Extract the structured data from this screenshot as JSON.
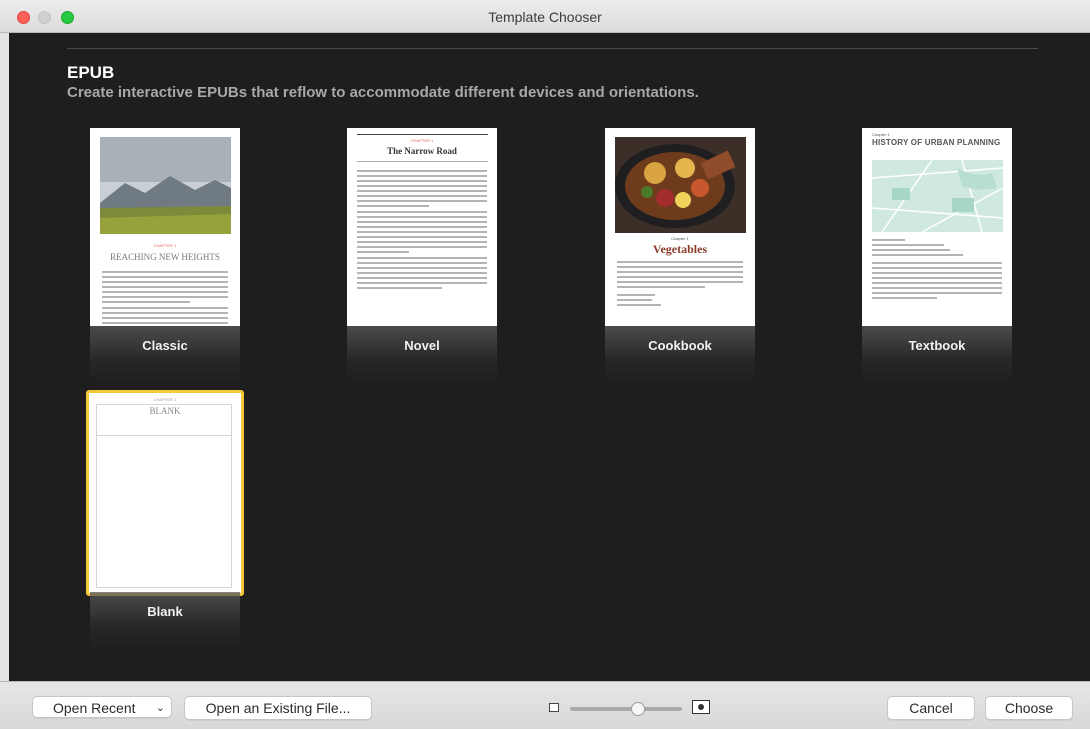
{
  "window": {
    "title": "Template Chooser"
  },
  "section": {
    "title": "EPUB",
    "description": "Create interactive EPUBs that reflow to accommodate different devices and orientations."
  },
  "templates": [
    {
      "label": "Classic",
      "chapter": "CHAPTER 1",
      "heading": "REACHING NEW HEIGHTS"
    },
    {
      "label": "Novel",
      "chapter": "CHAPTER 1",
      "heading": "The Narrow Road"
    },
    {
      "label": "Cookbook",
      "chapter": "Chapter 1",
      "heading": "Vegetables"
    },
    {
      "label": "Textbook",
      "chapter": "Chapter 1",
      "heading": "HISTORY OF URBAN PLANNING"
    },
    {
      "label": "Blank",
      "chapter": "CHAPTER 1",
      "heading": "BLANK",
      "selected": true
    }
  ],
  "footer": {
    "open_recent": "Open Recent",
    "open_existing": "Open an Existing File...",
    "cancel": "Cancel",
    "choose": "Choose",
    "thumbnail_size": 0.55
  },
  "colors": {
    "selection": "#f3c93b",
    "accent_red": "#fe5f57",
    "accent_green": "#28c840"
  }
}
